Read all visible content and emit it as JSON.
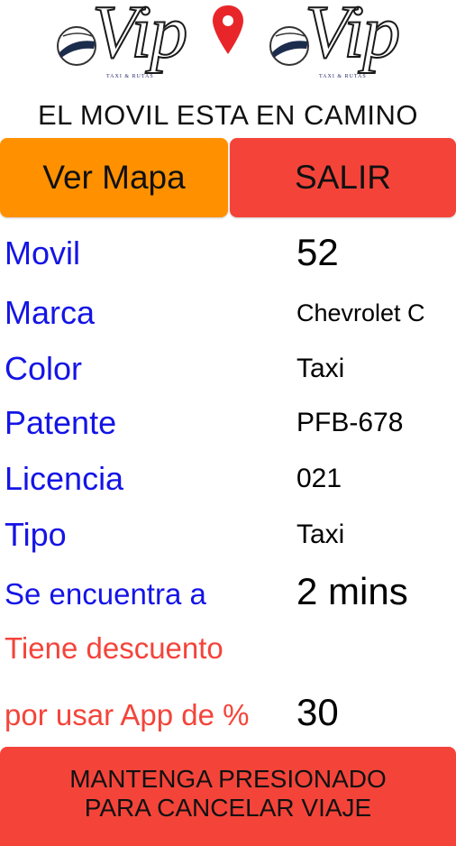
{
  "brand": {
    "logo_text": "Vip",
    "logo_tagline": "TAXI & RUTAS"
  },
  "status_title": "EL MOVIL ESTA EN CAMINO",
  "actions": {
    "map_label": "Ver Mapa",
    "exit_label": "SALIR"
  },
  "vehicle": [
    {
      "label": "Movil",
      "value": "52"
    },
    {
      "label": "Marca",
      "value": "Chevrolet  C"
    },
    {
      "label": "Color",
      "value": "Taxi"
    },
    {
      "label": "Patente",
      "value": "PFB-678"
    },
    {
      "label": "Licencia",
      "value": "021"
    },
    {
      "label": "Tipo",
      "value": "Taxi"
    },
    {
      "label": "Se encuentra a",
      "value": "2 mins"
    }
  ],
  "discount": {
    "line1": "Tiene descuento",
    "line2": "por usar App de %",
    "value": "30"
  },
  "cancel": {
    "line1": "MANTENGA PRESIONADO",
    "line2": "PARA CANCELAR VIAJE"
  },
  "colors": {
    "orange": "#ff9100",
    "red": "#f4443a",
    "label_blue": "#1414e6"
  }
}
